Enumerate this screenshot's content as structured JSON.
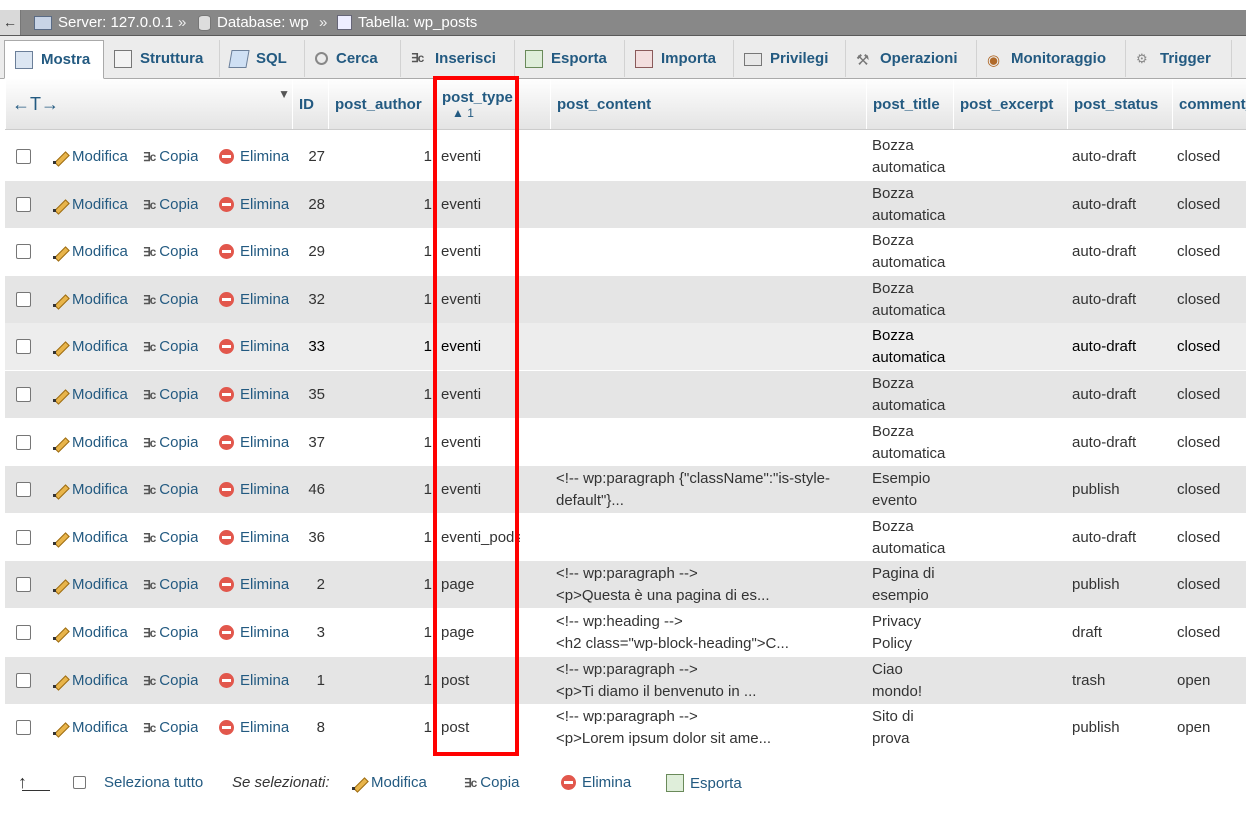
{
  "breadcrumb": {
    "back": "←",
    "server": "Server: 127.0.0.1",
    "database": "Database: wp",
    "table": "Tabella: wp_posts",
    "separator": "»"
  },
  "tabs": [
    {
      "label": "Mostra",
      "icon": "browse-icon",
      "active": true
    },
    {
      "label": "Struttura",
      "icon": "structure-icon"
    },
    {
      "label": "SQL",
      "icon": "sql-icon"
    },
    {
      "label": "Cerca",
      "icon": "search-icon"
    },
    {
      "label": "Inserisci",
      "icon": "insert-icon"
    },
    {
      "label": "Esporta",
      "icon": "export-icon"
    },
    {
      "label": "Importa",
      "icon": "import-icon"
    },
    {
      "label": "Privilegi",
      "icon": "privileges-icon"
    },
    {
      "label": "Operazioni",
      "icon": "wrench-icon"
    },
    {
      "label": "Monitoraggio",
      "icon": "eye-icon"
    },
    {
      "label": "Trigger",
      "icon": "trigger-icon"
    }
  ],
  "table": {
    "columns_arrows": "←T→",
    "headers": {
      "id": "ID",
      "post_author": "post_author",
      "post_type": "post_type",
      "sort_index": "1",
      "post_content": "post_content",
      "post_title": "post_title",
      "post_excerpt": "post_excerpt",
      "post_status": "post_status",
      "comment": "comment_"
    },
    "actions": {
      "edit": "Modifica",
      "copy": "Copia",
      "delete": "Elimina"
    },
    "rows": [
      {
        "id": "27",
        "author": "1",
        "type": "eventi",
        "content1": "",
        "content2": "",
        "title1": "Bozza",
        "title2": "automatica",
        "status": "auto-draft",
        "comment": "closed"
      },
      {
        "id": "28",
        "author": "1",
        "type": "eventi",
        "content1": "",
        "content2": "",
        "title1": "Bozza",
        "title2": "automatica",
        "status": "auto-draft",
        "comment": "closed"
      },
      {
        "id": "29",
        "author": "1",
        "type": "eventi",
        "content1": "",
        "content2": "",
        "title1": "Bozza",
        "title2": "automatica",
        "status": "auto-draft",
        "comment": "closed"
      },
      {
        "id": "32",
        "author": "1",
        "type": "eventi",
        "content1": "",
        "content2": "",
        "title1": "Bozza",
        "title2": "automatica",
        "status": "auto-draft",
        "comment": "closed"
      },
      {
        "id": "33",
        "author": "1",
        "type": "eventi",
        "content1": "",
        "content2": "",
        "title1": "Bozza",
        "title2": "automatica",
        "status": "auto-draft",
        "comment": "closed"
      },
      {
        "id": "35",
        "author": "1",
        "type": "eventi",
        "content1": "",
        "content2": "",
        "title1": "Bozza",
        "title2": "automatica",
        "status": "auto-draft",
        "comment": "closed"
      },
      {
        "id": "37",
        "author": "1",
        "type": "eventi",
        "content1": "",
        "content2": "",
        "title1": "Bozza",
        "title2": "automatica",
        "status": "auto-draft",
        "comment": "closed"
      },
      {
        "id": "46",
        "author": "1",
        "type": "eventi",
        "content1": "<!-- wp:paragraph {\"className\":\"is-style-",
        "content2": "default\"}...",
        "title1": "Esempio",
        "title2": "evento",
        "status": "publish",
        "comment": "closed"
      },
      {
        "id": "36",
        "author": "1",
        "type": "eventi_pods",
        "content1": "",
        "content2": "",
        "title1": "Bozza",
        "title2": "automatica",
        "status": "auto-draft",
        "comment": "closed"
      },
      {
        "id": "2",
        "author": "1",
        "type": "page",
        "content1": "<!-- wp:paragraph -->",
        "content2": "<p>Questa è una pagina di es...",
        "title1": "Pagina di",
        "title2": "esempio",
        "status": "publish",
        "comment": "closed"
      },
      {
        "id": "3",
        "author": "1",
        "type": "page",
        "content1": "<!-- wp:heading -->",
        "content2": "<h2 class=\"wp-block-heading\">C...",
        "title1": "Privacy",
        "title2": "Policy",
        "status": "draft",
        "comment": "closed"
      },
      {
        "id": "1",
        "author": "1",
        "type": "post",
        "content1": "<!-- wp:paragraph -->",
        "content2": "<p>Ti diamo il benvenuto in ...",
        "title1": "Ciao",
        "title2": "mondo!",
        "status": "trash",
        "comment": "open"
      },
      {
        "id": "8",
        "author": "1",
        "type": "post",
        "content1": "<!-- wp:paragraph -->",
        "content2": "<p>Lorem ipsum dolor sit ame...",
        "title1": "Sito di",
        "title2": "prova",
        "status": "publish",
        "comment": "open"
      }
    ]
  },
  "footer": {
    "select_all": "Seleziona tutto",
    "with_selected": "Se selezionati:",
    "edit": "Modifica",
    "copy": "Copia",
    "delete": "Elimina",
    "export": "Esporta"
  },
  "colors": {
    "highlight": "#ff0000",
    "link": "#235a81",
    "row_alt": "#e5e5e5"
  }
}
